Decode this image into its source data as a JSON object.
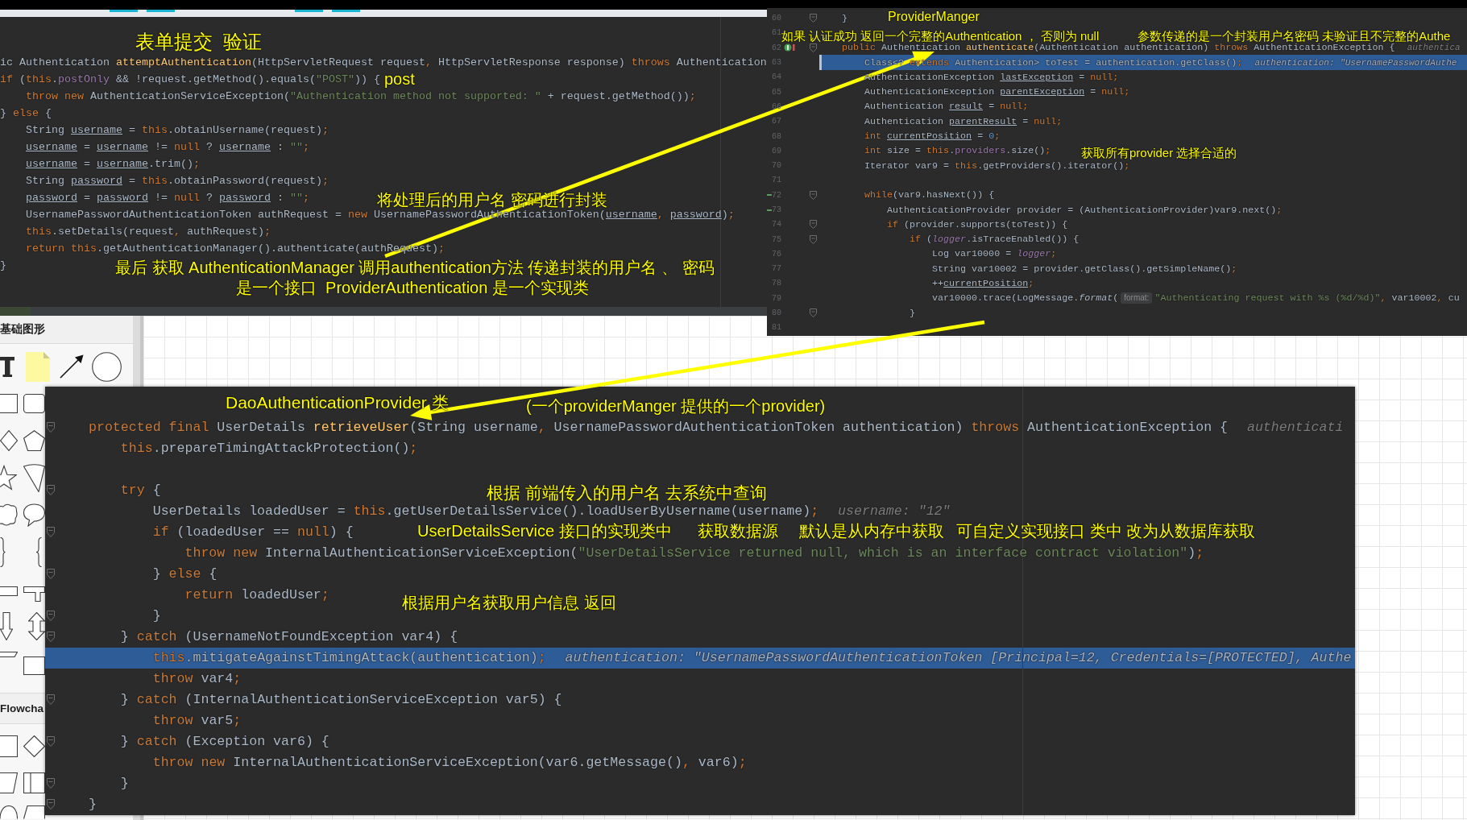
{
  "editor_top_left": {
    "lines": [
      {
        "code": [
          {
            "kind": "plain",
            "text": "ic Authentication "
          },
          {
            "kind": "declaration",
            "text": "attemptAuthentication"
          },
          {
            "kind": "plain",
            "text": "(HttpServletRequest request"
          },
          {
            "kind": "keyword",
            "text": ", "
          },
          {
            "kind": "plain",
            "text": "HttpServletResponse response) "
          },
          {
            "kind": "keyword",
            "text": "throws "
          },
          {
            "kind": "plain",
            "text": "Authentication"
          }
        ]
      },
      {
        "code": [
          {
            "kind": "keyword",
            "text": "if "
          },
          {
            "kind": "plain",
            "text": "("
          },
          {
            "kind": "keyword",
            "text": "this"
          },
          {
            "kind": "plain",
            "text": "."
          },
          {
            "kind": "field",
            "text": "postOnly "
          },
          {
            "kind": "plain",
            "text": "&& !request.getMethod().equals("
          },
          {
            "kind": "string",
            "text": "\"POST\""
          },
          {
            "kind": "plain",
            "text": ")) {"
          }
        ]
      },
      {
        "code": [
          {
            "kind": "keyword",
            "text": "    throw new "
          },
          {
            "kind": "plain",
            "text": "AuthenticationServiceException("
          },
          {
            "kind": "string",
            "text": "\"Authentication method not supported: \""
          },
          {
            "kind": "plain",
            "text": " + request.getMethod())"
          },
          {
            "kind": "keyword",
            "text": ";"
          }
        ]
      },
      {
        "code": [
          {
            "kind": "plain",
            "text": "} "
          },
          {
            "kind": "keyword",
            "text": "else "
          },
          {
            "kind": "plain",
            "text": "{"
          }
        ]
      },
      {
        "code": [
          {
            "kind": "plain",
            "text": "    String "
          },
          {
            "kind": "reassigned",
            "text": "username"
          },
          {
            "kind": "plain",
            "text": " = "
          },
          {
            "kind": "keyword",
            "text": "this"
          },
          {
            "kind": "plain",
            "text": ".obtainUsername(request)"
          },
          {
            "kind": "keyword",
            "text": ";"
          }
        ]
      },
      {
        "code": [
          {
            "kind": "reassigned",
            "text": "    username"
          },
          {
            "kind": "plain",
            "text": " = "
          },
          {
            "kind": "reassigned",
            "text": "username"
          },
          {
            "kind": "plain",
            "text": " != "
          },
          {
            "kind": "keyword",
            "text": "null "
          },
          {
            "kind": "plain",
            "text": "? "
          },
          {
            "kind": "reassigned",
            "text": "username"
          },
          {
            "kind": "plain",
            "text": " : "
          },
          {
            "kind": "string",
            "text": "\"\""
          },
          {
            "kind": "keyword",
            "text": ";"
          }
        ]
      },
      {
        "code": [
          {
            "kind": "reassigned",
            "text": "    username"
          },
          {
            "kind": "plain",
            "text": " = "
          },
          {
            "kind": "reassigned",
            "text": "username"
          },
          {
            "kind": "plain",
            "text": ".trim()"
          },
          {
            "kind": "keyword",
            "text": ";"
          }
        ]
      },
      {
        "code": [
          {
            "kind": "plain",
            "text": "    String "
          },
          {
            "kind": "reassigned",
            "text": "password"
          },
          {
            "kind": "plain",
            "text": " = "
          },
          {
            "kind": "keyword",
            "text": "this"
          },
          {
            "kind": "plain",
            "text": ".obtainPassword(request)"
          },
          {
            "kind": "keyword",
            "text": ";"
          }
        ]
      },
      {
        "code": [
          {
            "kind": "reassigned",
            "text": "    password"
          },
          {
            "kind": "plain",
            "text": " = "
          },
          {
            "kind": "reassigned",
            "text": "password"
          },
          {
            "kind": "plain",
            "text": " != "
          },
          {
            "kind": "keyword",
            "text": "null "
          },
          {
            "kind": "plain",
            "text": "? "
          },
          {
            "kind": "reassigned",
            "text": "password"
          },
          {
            "kind": "plain",
            "text": " : "
          },
          {
            "kind": "string",
            "text": "\"\""
          },
          {
            "kind": "keyword",
            "text": ";"
          }
        ]
      },
      {
        "code": [
          {
            "kind": "plain",
            "text": "    UsernamePasswordAuthenticationToken authRequest = "
          },
          {
            "kind": "keyword",
            "text": "new "
          },
          {
            "kind": "plain",
            "text": "UsernamePasswordAuthenticationToken("
          },
          {
            "kind": "reassigned",
            "text": "username"
          },
          {
            "kind": "keyword",
            "text": ", "
          },
          {
            "kind": "reassigned",
            "text": "password"
          },
          {
            "kind": "plain",
            "text": ")"
          },
          {
            "kind": "keyword",
            "text": ";"
          }
        ]
      },
      {
        "code": [
          {
            "kind": "keyword",
            "text": "    this"
          },
          {
            "kind": "plain",
            "text": ".setDetails(request"
          },
          {
            "kind": "keyword",
            "text": ", "
          },
          {
            "kind": "plain",
            "text": "authRequest)"
          },
          {
            "kind": "keyword",
            "text": ";"
          }
        ]
      },
      {
        "code": [
          {
            "kind": "keyword",
            "text": "    return this"
          },
          {
            "kind": "plain",
            "text": ".getAuthenticationManager().authenticate(authRequest)"
          },
          {
            "kind": "keyword",
            "text": ";"
          }
        ]
      },
      {
        "code": [
          {
            "kind": "plain",
            "text": "}"
          }
        ]
      }
    ],
    "annotations": [
      "表单提交  验证",
      "post",
      "将处理后的用户名 密码进行封装",
      "最后 获取 AuthenticationManager 调用authentication方法 传递封装的用户名 、 密码",
      "是一个接口  ProviderAuthentication 是一个实现类"
    ]
  },
  "editor_top_right": {
    "lines": [
      {
        "number": "60",
        "highlighted": false,
        "fold_marker": true,
        "change_marker": false,
        "implements_marker": false,
        "code": [
          {
            "kind": "plain",
            "text": "}"
          }
        ]
      },
      {
        "number": "61",
        "highlighted": false,
        "fold_marker": false,
        "change_marker": false,
        "implements_marker": false
      },
      {
        "number": "62",
        "highlighted": false,
        "fold_marker": true,
        "change_marker": false,
        "implements_marker": true,
        "code": [
          {
            "kind": "keyword",
            "text": "public "
          },
          {
            "kind": "plain",
            "text": "Authentication "
          },
          {
            "kind": "declaration",
            "text": "authenticate"
          },
          {
            "kind": "plain",
            "text": "(Authentication authentication) "
          },
          {
            "kind": "keyword",
            "text": "throws "
          },
          {
            "kind": "plain",
            "text": "AuthenticationException {"
          }
        ],
        "hint": "authentica"
      },
      {
        "number": "63",
        "highlighted": true,
        "fold_marker": false,
        "change_marker": false,
        "implements_marker": false,
        "code": [
          {
            "kind": "plain",
            "text": "    Class<? "
          },
          {
            "kind": "keyword",
            "text": "extends "
          },
          {
            "kind": "plain",
            "text": "Authentication> toTest = authentication.getClass()"
          },
          {
            "kind": "keyword",
            "text": ";"
          }
        ],
        "hint": "authentication: \"UsernamePasswordAuthe"
      },
      {
        "number": "64",
        "highlighted": false,
        "fold_marker": false,
        "change_marker": false,
        "implements_marker": false,
        "code": [
          {
            "kind": "plain",
            "text": "    AuthenticationException "
          },
          {
            "kind": "reassigned",
            "text": "lastException"
          },
          {
            "kind": "plain",
            "text": " = "
          },
          {
            "kind": "keyword",
            "text": "null;"
          }
        ]
      },
      {
        "number": "65",
        "highlighted": false,
        "fold_marker": false,
        "change_marker": false,
        "implements_marker": false,
        "code": [
          {
            "kind": "plain",
            "text": "    AuthenticationException "
          },
          {
            "kind": "reassigned",
            "text": "parentException"
          },
          {
            "kind": "plain",
            "text": " = "
          },
          {
            "kind": "keyword",
            "text": "null;"
          }
        ]
      },
      {
        "number": "66",
        "highlighted": false,
        "fold_marker": false,
        "change_marker": false,
        "implements_marker": false,
        "code": [
          {
            "kind": "plain",
            "text": "    Authentication "
          },
          {
            "kind": "reassigned",
            "text": "result"
          },
          {
            "kind": "plain",
            "text": " = "
          },
          {
            "kind": "keyword",
            "text": "null;"
          }
        ]
      },
      {
        "number": "67",
        "highlighted": false,
        "fold_marker": false,
        "change_marker": false,
        "implements_marker": false,
        "code": [
          {
            "kind": "plain",
            "text": "    Authentication "
          },
          {
            "kind": "reassigned",
            "text": "parentResult"
          },
          {
            "kind": "plain",
            "text": " = "
          },
          {
            "kind": "keyword",
            "text": "null;"
          }
        ]
      },
      {
        "number": "68",
        "highlighted": false,
        "fold_marker": false,
        "change_marker": false,
        "implements_marker": false,
        "code": [
          {
            "kind": "keyword",
            "text": "    int "
          },
          {
            "kind": "reassigned",
            "text": "currentPosition"
          },
          {
            "kind": "plain",
            "text": " = "
          },
          {
            "kind": "number",
            "text": "0"
          },
          {
            "kind": "keyword",
            "text": ";"
          }
        ]
      },
      {
        "number": "69",
        "highlighted": false,
        "fold_marker": false,
        "change_marker": false,
        "implements_marker": false,
        "code": [
          {
            "kind": "keyword",
            "text": "    int "
          },
          {
            "kind": "plain",
            "text": "size = "
          },
          {
            "kind": "keyword",
            "text": "this"
          },
          {
            "kind": "plain",
            "text": "."
          },
          {
            "kind": "field",
            "text": "providers"
          },
          {
            "kind": "plain",
            "text": ".size()"
          },
          {
            "kind": "keyword",
            "text": ";"
          }
        ]
      },
      {
        "number": "70",
        "highlighted": false,
        "fold_marker": false,
        "change_marker": false,
        "implements_marker": false,
        "code": [
          {
            "kind": "plain",
            "text": "    Iterator var9 = "
          },
          {
            "kind": "keyword",
            "text": "this"
          },
          {
            "kind": "plain",
            "text": ".getProviders().iterator()"
          },
          {
            "kind": "keyword",
            "text": ";"
          }
        ]
      },
      {
        "number": "71",
        "highlighted": false,
        "fold_marker": false,
        "change_marker": false,
        "implements_marker": false
      },
      {
        "number": "72",
        "highlighted": false,
        "fold_marker": true,
        "change_marker": true,
        "implements_marker": false,
        "code": [
          {
            "kind": "keyword",
            "text": "    while"
          },
          {
            "kind": "plain",
            "text": "(var9.hasNext()) {"
          }
        ]
      },
      {
        "number": "73",
        "highlighted": false,
        "fold_marker": false,
        "change_marker": true,
        "implements_marker": false,
        "code": [
          {
            "kind": "plain",
            "text": "        AuthenticationProvider provider = (AuthenticationProvider)var9.next()"
          },
          {
            "kind": "keyword",
            "text": ";"
          }
        ]
      },
      {
        "number": "74",
        "highlighted": false,
        "fold_marker": true,
        "change_marker": false,
        "implements_marker": false,
        "code": [
          {
            "kind": "keyword",
            "text": "        if "
          },
          {
            "kind": "plain",
            "text": "(provider.supports(toTest)) {"
          }
        ]
      },
      {
        "number": "75",
        "highlighted": false,
        "fold_marker": true,
        "change_marker": false,
        "implements_marker": false,
        "code": [
          {
            "kind": "keyword",
            "text": "            if "
          },
          {
            "kind": "plain",
            "text": "("
          },
          {
            "kind": "staticfield",
            "text": "logger"
          },
          {
            "kind": "plain",
            "text": ".isTraceEnabled()) {"
          }
        ]
      },
      {
        "number": "76",
        "highlighted": false,
        "fold_marker": false,
        "change_marker": false,
        "implements_marker": false,
        "code": [
          {
            "kind": "plain",
            "text": "                Log var10000 = "
          },
          {
            "kind": "staticfield",
            "text": "logger"
          },
          {
            "kind": "keyword",
            "text": ";"
          }
        ]
      },
      {
        "number": "77",
        "highlighted": false,
        "fold_marker": false,
        "change_marker": false,
        "implements_marker": false,
        "code": [
          {
            "kind": "plain",
            "text": "                String var10002 = provider.getClass().getSimpleName()"
          },
          {
            "kind": "keyword",
            "text": ";"
          }
        ]
      },
      {
        "number": "78",
        "highlighted": false,
        "fold_marker": false,
        "change_marker": false,
        "implements_marker": false,
        "code": [
          {
            "kind": "plain",
            "text": "                ++"
          },
          {
            "kind": "reassigned",
            "text": "currentPosition"
          },
          {
            "kind": "keyword",
            "text": ";"
          }
        ]
      },
      {
        "number": "79",
        "highlighted": false,
        "fold_marker": false,
        "change_marker": false,
        "implements_marker": false,
        "code": [
          {
            "kind": "plain",
            "text": "                var10000.trace(LogMessage."
          },
          {
            "kind": "staticcall",
            "text": "format"
          },
          {
            "kind": "plain",
            "text": "("
          },
          {
            "kind": "inlay",
            "text": "format:"
          },
          {
            "kind": "string",
            "text": "\"Authenticating request with %s (%d/%d)\""
          },
          {
            "kind": "keyword",
            "text": ", "
          },
          {
            "kind": "plain",
            "text": "var10002"
          },
          {
            "kind": "keyword",
            "text": ", "
          },
          {
            "kind": "plain",
            "text": "cu"
          }
        ]
      },
      {
        "number": "80",
        "highlighted": false,
        "fold_marker": true,
        "change_marker": false,
        "implements_marker": false,
        "code": [
          {
            "kind": "plain",
            "text": "            }"
          }
        ]
      },
      {
        "number": "81",
        "highlighted": false,
        "fold_marker": false,
        "change_marker": false,
        "implements_marker": false
      }
    ],
    "annotations": [
      "ProviderManger",
      "如果 认证成功 返回一个完整的Authentication ， 否则为 null",
      "参数传递的是一个封装用户名密码 未验证且不完整的Authe",
      "获取所有provider 选择合适的"
    ]
  },
  "editor_bottom": {
    "lines": [
      {
        "highlighted": false,
        "fold_marker": false
      },
      {
        "highlighted": false,
        "fold_marker": true,
        "code": [
          {
            "kind": "keyword",
            "text": "protected final "
          },
          {
            "kind": "plain",
            "text": "UserDetails "
          },
          {
            "kind": "declaration",
            "text": "retrieveUser"
          },
          {
            "kind": "plain",
            "text": "(String username"
          },
          {
            "kind": "keyword",
            "text": ", "
          },
          {
            "kind": "plain",
            "text": "UsernamePasswordAuthenticationToken authentication) "
          },
          {
            "kind": "keyword",
            "text": "throws "
          },
          {
            "kind": "plain",
            "text": "AuthenticationException {"
          }
        ],
        "hint": "authenticati"
      },
      {
        "highlighted": false,
        "fold_marker": false,
        "code": [
          {
            "kind": "keyword",
            "text": "    this"
          },
          {
            "kind": "plain",
            "text": ".prepareTimingAttackProtection()"
          },
          {
            "kind": "keyword",
            "text": ";"
          }
        ]
      },
      {
        "highlighted": false,
        "fold_marker": false
      },
      {
        "highlighted": false,
        "fold_marker": true,
        "code": [
          {
            "kind": "keyword",
            "text": "    try "
          },
          {
            "kind": "plain",
            "text": "{"
          }
        ]
      },
      {
        "highlighted": false,
        "fold_marker": false,
        "code": [
          {
            "kind": "plain",
            "text": "        UserDetails loadedUser = "
          },
          {
            "kind": "keyword",
            "text": "this"
          },
          {
            "kind": "plain",
            "text": ".getUserDetailsService().loadUserByUsername(username)"
          },
          {
            "kind": "keyword",
            "text": ";"
          }
        ],
        "hint": "username: \"12\""
      },
      {
        "highlighted": false,
        "fold_marker": true,
        "code": [
          {
            "kind": "keyword",
            "text": "        if "
          },
          {
            "kind": "plain",
            "text": "(loadedUser == "
          },
          {
            "kind": "keyword",
            "text": "null"
          },
          {
            "kind": "plain",
            "text": ") {"
          }
        ]
      },
      {
        "highlighted": false,
        "fold_marker": false,
        "code": [
          {
            "kind": "keyword",
            "text": "            throw new "
          },
          {
            "kind": "plain",
            "text": "InternalAuthenticationServiceException("
          },
          {
            "kind": "string",
            "text": "\"UserDetailsService returned null, which is an interface contract violation\""
          },
          {
            "kind": "plain",
            "text": ")"
          },
          {
            "kind": "keyword",
            "text": ";"
          }
        ]
      },
      {
        "highlighted": false,
        "fold_marker": true,
        "code": [
          {
            "kind": "plain",
            "text": "        } "
          },
          {
            "kind": "keyword",
            "text": "else "
          },
          {
            "kind": "plain",
            "text": "{"
          }
        ]
      },
      {
        "highlighted": false,
        "fold_marker": false,
        "code": [
          {
            "kind": "keyword",
            "text": "            return "
          },
          {
            "kind": "plain",
            "text": "loadedUser"
          },
          {
            "kind": "keyword",
            "text": ";"
          }
        ]
      },
      {
        "highlighted": false,
        "fold_marker": true,
        "code": [
          {
            "kind": "plain",
            "text": "        }"
          }
        ]
      },
      {
        "highlighted": false,
        "fold_marker": true,
        "code": [
          {
            "kind": "plain",
            "text": "    } "
          },
          {
            "kind": "keyword",
            "text": "catch "
          },
          {
            "kind": "plain",
            "text": "(UsernameNotFoundException var4) {"
          }
        ]
      },
      {
        "highlighted": true,
        "fold_marker": false,
        "code": [
          {
            "kind": "keyword",
            "text": "        this"
          },
          {
            "kind": "plain",
            "text": ".mitigateAgainstTimingAttack(authentication)"
          },
          {
            "kind": "keyword",
            "text": ";"
          }
        ],
        "hint": "authentication: \"UsernamePasswordAuthenticationToken [Principal=12, Credentials=[PROTECTED], Authe"
      },
      {
        "highlighted": false,
        "fold_marker": false,
        "code": [
          {
            "kind": "keyword",
            "text": "        throw "
          },
          {
            "kind": "plain",
            "text": "var4"
          },
          {
            "kind": "keyword",
            "text": ";"
          }
        ]
      },
      {
        "highlighted": false,
        "fold_marker": true,
        "code": [
          {
            "kind": "plain",
            "text": "    } "
          },
          {
            "kind": "keyword",
            "text": "catch "
          },
          {
            "kind": "plain",
            "text": "(InternalAuthenticationServiceException var5) {"
          }
        ]
      },
      {
        "highlighted": false,
        "fold_marker": false,
        "code": [
          {
            "kind": "keyword",
            "text": "        throw "
          },
          {
            "kind": "plain",
            "text": "var5"
          },
          {
            "kind": "keyword",
            "text": ";"
          }
        ]
      },
      {
        "highlighted": false,
        "fold_marker": true,
        "code": [
          {
            "kind": "plain",
            "text": "    } "
          },
          {
            "kind": "keyword",
            "text": "catch "
          },
          {
            "kind": "plain",
            "text": "(Exception var6) {"
          }
        ]
      },
      {
        "highlighted": false,
        "fold_marker": false,
        "code": [
          {
            "kind": "keyword",
            "text": "        throw new "
          },
          {
            "kind": "plain",
            "text": "InternalAuthenticationServiceException(var6.getMessage()"
          },
          {
            "kind": "keyword",
            "text": ", "
          },
          {
            "kind": "plain",
            "text": "var6)"
          },
          {
            "kind": "keyword",
            "text": ";"
          }
        ]
      },
      {
        "highlighted": false,
        "fold_marker": true,
        "code": [
          {
            "kind": "plain",
            "text": "    }"
          }
        ]
      },
      {
        "highlighted": false,
        "fold_marker": true,
        "code": [
          {
            "kind": "plain",
            "text": "}"
          }
        ]
      }
    ],
    "annotations": [
      "DaoAuthenticationProvider 类",
      "(一个providerManger 提供的一个provider)",
      "根据 前端传入的用户名 去系统中查询",
      "UserDetailsService 接口的实现类中",
      "获取数据源",
      "默认是从内存中获取",
      "可自定义实现接口 类中 改为从数据库获取",
      "根据用户名获取用户信息 返回"
    ]
  },
  "shape_sidebar": {
    "sections": [
      {
        "title": "基础图形"
      },
      {
        "title": "Flowcha"
      }
    ]
  }
}
